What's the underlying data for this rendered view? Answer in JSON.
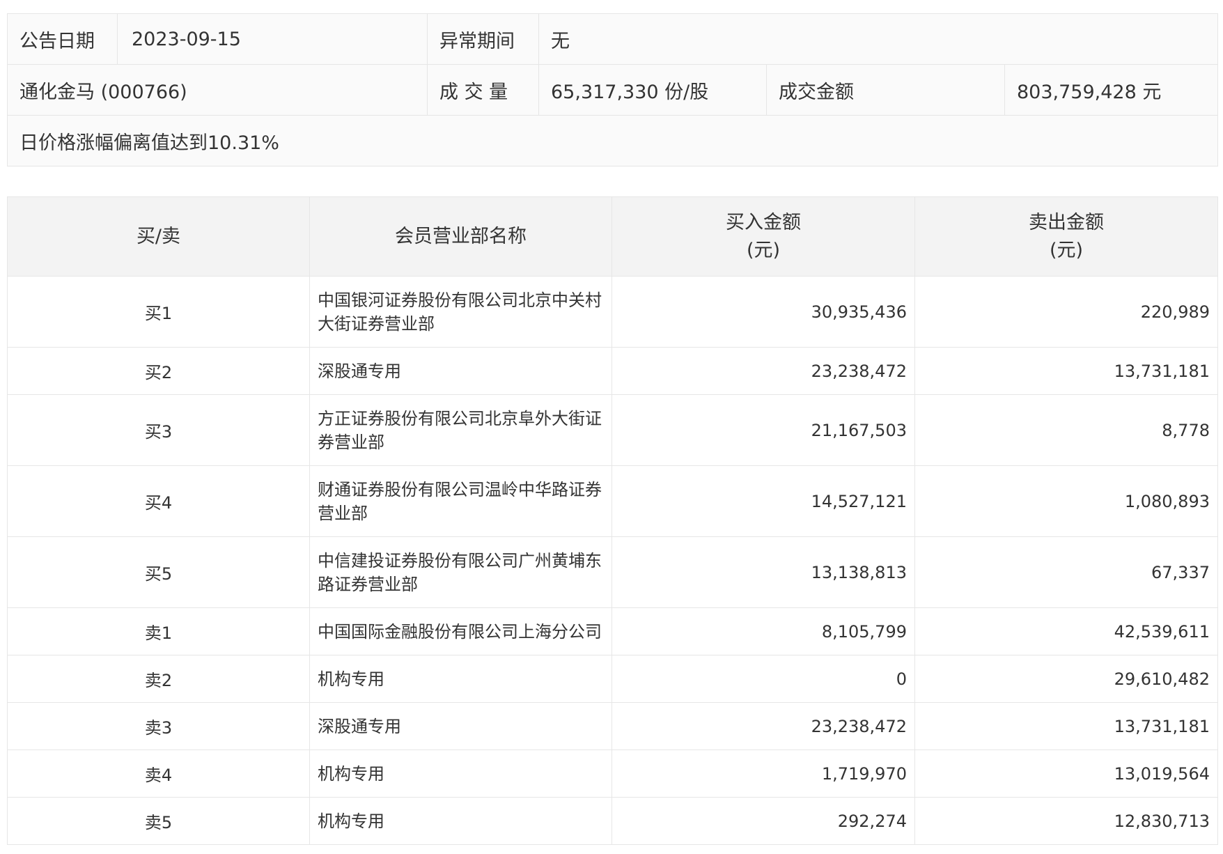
{
  "summary": {
    "announce_date_label": "公告日期",
    "announce_date": "2023-09-15",
    "abnormal_period_label": "异常期间",
    "abnormal_period": "无",
    "stock": "通化金马 (000766)",
    "volume_label": "成 交 量",
    "volume": "65,317,330 份/股",
    "turnover_label": "成交金额",
    "turnover": "803,759,428 元",
    "reason": "日价格涨幅偏离值达到10.31%"
  },
  "table": {
    "headers": {
      "side": "买/卖",
      "branch": "会员营业部名称",
      "buy_line1": "买入金额",
      "buy_line2": "(元)",
      "sell_line1": "卖出金额",
      "sell_line2": "(元)"
    },
    "rows": [
      {
        "side": "买1",
        "branch": "中国银河证券股份有限公司北京中关村大街证券营业部",
        "buy": "30,935,436",
        "sell": "220,989"
      },
      {
        "side": "买2",
        "branch": "深股通专用",
        "buy": "23,238,472",
        "sell": "13,731,181"
      },
      {
        "side": "买3",
        "branch": "方正证券股份有限公司北京阜外大街证券营业部",
        "buy": "21,167,503",
        "sell": "8,778"
      },
      {
        "side": "买4",
        "branch": "财通证券股份有限公司温岭中华路证券营业部",
        "buy": "14,527,121",
        "sell": "1,080,893"
      },
      {
        "side": "买5",
        "branch": "中信建投证券股份有限公司广州黄埔东路证券营业部",
        "buy": "13,138,813",
        "sell": "67,337"
      },
      {
        "side": "卖1",
        "branch": "中国国际金融股份有限公司上海分公司",
        "buy": "8,105,799",
        "sell": "42,539,611"
      },
      {
        "side": "卖2",
        "branch": "机构专用",
        "buy": "0",
        "sell": "29,610,482"
      },
      {
        "side": "卖3",
        "branch": "深股通专用",
        "buy": "23,238,472",
        "sell": "13,731,181"
      },
      {
        "side": "卖4",
        "branch": "机构专用",
        "buy": "1,719,970",
        "sell": "13,019,564"
      },
      {
        "side": "卖5",
        "branch": "机构专用",
        "buy": "292,274",
        "sell": "12,830,713"
      }
    ]
  }
}
